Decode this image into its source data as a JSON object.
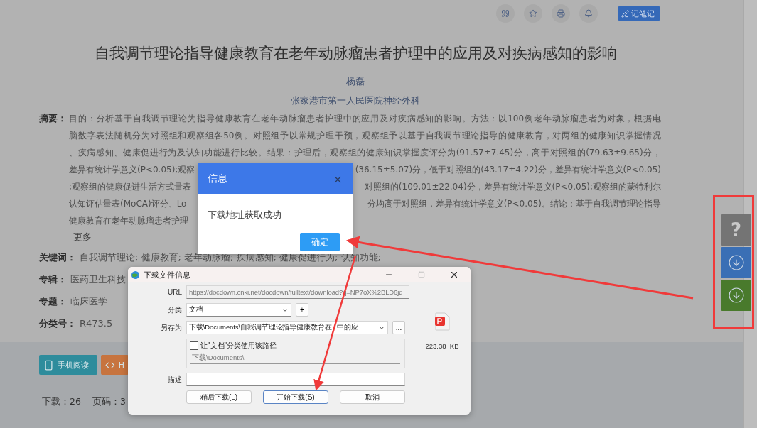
{
  "toolbar": {
    "note_button": "记笔记"
  },
  "article": {
    "title": "自我调节理论指导健康教育在老年动脉瘤患者护理中的应用及对疾病感知的影响",
    "author": "杨磊",
    "affiliation": "张家港市第一人民医院神经外科",
    "abstract": {
      "label": "摘要：",
      "lines": [
        {
          "left": "目的：分析基于自我调节理论为指导健康教育在老年动脉瘤患者护理中的应用及对疾病感知的影响。方法：以100例老年动脉瘤患者为对象，根据电"
        },
        {
          "left": "脑数字表法随机分为对照组和观察组各50例。对照组予以常规护理干预，观察组予以基于自我调节理论指导的健康教育，对两组的健康知识掌握情况"
        },
        {
          "left": "、疾病感知、健康促进行为及认知功能进行比较。结果：护理后，观察组的健康知识掌握度评分为(91.57±7.45)分，高于对照组的(79.63±9.65)分，"
        },
        {
          "left": "差异有统计学意义(P<0.05);观察",
          "right": "(36.15±5.07)分，低于对照组的(43.17±4.22)分，差异有统计学意义(P<0.05)"
        },
        {
          "left": ";观察组的健康促进生活方式量表",
          "right": "对照组的(109.01±22.04)分，差异有统计学意义(P<0.05);观察组的蒙特利尔"
        },
        {
          "left": "认知评估量表(MoCA)评分、Lo",
          "right": "分均高于对照组，差异有统计学意义(P<0.05)。结论：基于自我调节理论指导"
        },
        {
          "left": "健康教育在老年动脉瘤患者护理"
        }
      ],
      "more": "更多"
    },
    "fields": [
      {
        "label": "关键词：",
        "value": "自我调节理论;  健康教育;  老年动脉瘤;  疾病感知;  健康促进行为;  认知功能;"
      },
      {
        "label": "专辑：",
        "value": "医药卫生科技"
      },
      {
        "label": "专题：",
        "value": "临床医学"
      },
      {
        "label": "分类号：",
        "value": "R473.5"
      }
    ]
  },
  "actions": [
    {
      "kind": "mobile",
      "label": "手机阅读"
    },
    {
      "kind": "html",
      "label": "H"
    }
  ],
  "stats": [
    "下载：26",
    "页码：3"
  ],
  "side_buttons": [
    {
      "kind": "help",
      "label": "?",
      "color": "#747474"
    },
    {
      "kind": "download",
      "color": "#3a6fb5"
    },
    {
      "kind": "download",
      "color": "#497a2c"
    }
  ],
  "message_dialog": {
    "title": "信息",
    "close": "×",
    "message": "下载地址获取成功",
    "button": "确定"
  },
  "download_window": {
    "title": "下载文件信息",
    "maximize_enabled": false,
    "url_label": "URL",
    "url": "https://docdown.cnki.net/docdown/fulltext/download?q=NP7oX%2BLD6jd",
    "category_label": "分类",
    "category": "文档",
    "add": "+",
    "save_label": "另存为",
    "save_path": "下载\\Documents\\自我调节理论指导健康教育在...中的应",
    "browse": "...",
    "remember": {
      "label": "让\"文档\"分类使用该路径",
      "checked": false
    },
    "default_path": "下载\\Documents\\",
    "desc_label": "描述",
    "file_size": "223.38  KB",
    "buttons": [
      "稍后下载(L)",
      "开始下载(S)",
      "取消"
    ]
  }
}
